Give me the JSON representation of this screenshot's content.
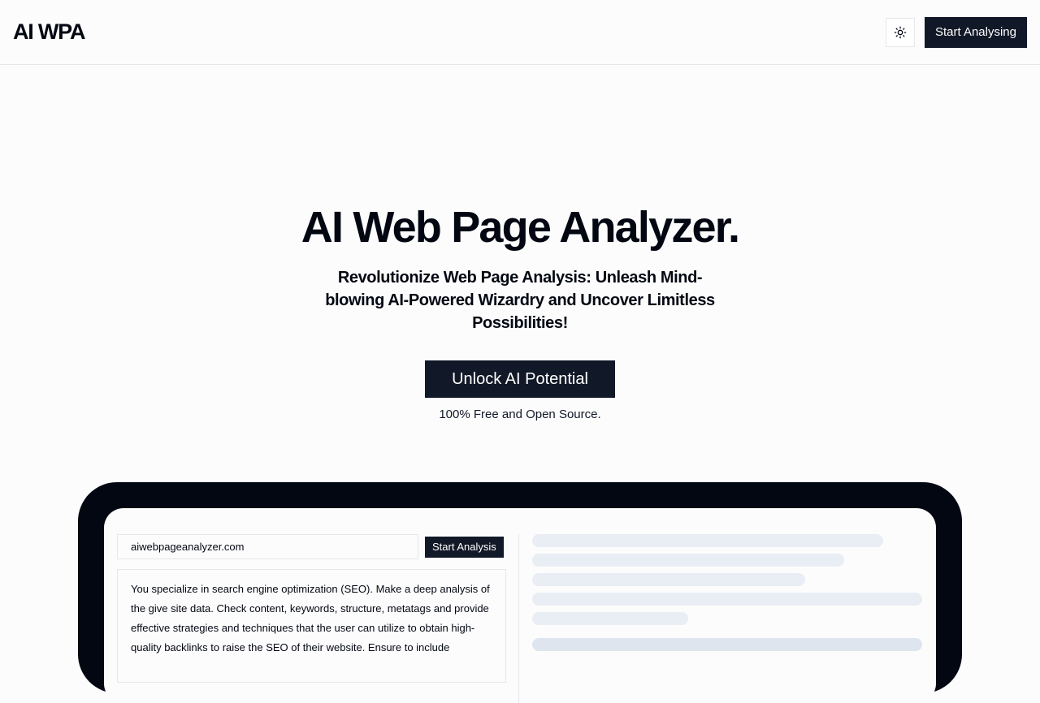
{
  "header": {
    "logo": "AI WPA",
    "theme_toggle_icon": "sun-icon",
    "cta_label": "Start Analysing"
  },
  "hero": {
    "title": "AI Web Page Analyzer.",
    "subtitle": "Revolutionize Web Page Analysis: Unleash Mind-blowing AI-Powered Wizardry and Uncover Limitless Possibilities!",
    "cta_label": "Unlock AI Potential",
    "note": "100% Free and Open Source."
  },
  "preview": {
    "url_value": "aiwebpageanalyzer.com",
    "analysis_button": "Start Analysis",
    "prompt_text": "You specialize in search engine optimization (SEO). Make a deep analysis of the give site data. Check content, keywords, structure, metatags and provide effective strategies and techniques that the user can utilize to obtain high-quality backlinks to raise the SEO of their website. Ensure to include"
  },
  "colors": {
    "primary": "#111827",
    "background": "#fcfcfc",
    "device_frame": "#030712",
    "skeleton": "#e9edf4"
  }
}
